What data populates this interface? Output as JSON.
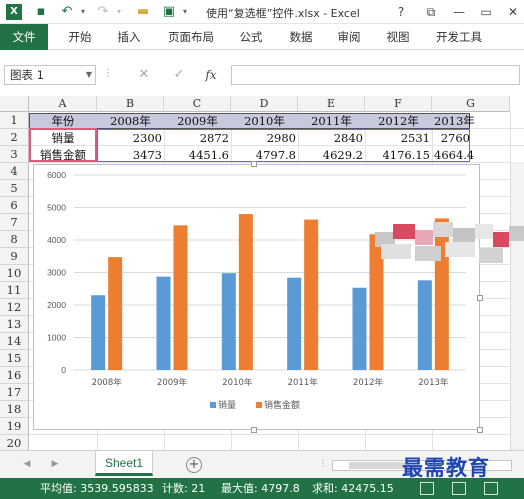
{
  "app": {
    "title": "使用“复选框”控件.xlsx - Excel",
    "logo": "X",
    "help_label": "?",
    "quick_access": [
      "save-icon",
      "undo-icon",
      "redo-icon",
      "open-icon",
      "print-preview-icon"
    ]
  },
  "ribbon": {
    "tabs": [
      "文件",
      "开始",
      "插入",
      "页面布局",
      "公式",
      "数据",
      "审阅",
      "视图",
      "开发工具"
    ]
  },
  "formula_bar": {
    "name_box": "图表 1",
    "cancel": "✕",
    "enter": "✓",
    "fx": "fx",
    "value": ""
  },
  "grid": {
    "columns": [
      "A",
      "B",
      "C",
      "D",
      "E",
      "F",
      "G"
    ],
    "rows": [
      "1",
      "2",
      "3",
      "4",
      "5",
      "6",
      "7",
      "8",
      "9",
      "10",
      "11",
      "12",
      "13",
      "14",
      "15",
      "16",
      "17",
      "18",
      "19",
      "20"
    ],
    "cells": {
      "r1": [
        "年份",
        "2008年",
        "2009年",
        "2010年",
        "2011年",
        "2012年",
        "2013年"
      ],
      "r2": [
        "销量",
        "2300",
        "2872",
        "2980",
        "2840",
        "2531",
        "2760"
      ],
      "r3": [
        "销售金额",
        "3473",
        "4451.6",
        "4797.8",
        "4629.2",
        "4176.15",
        "4664.4"
      ]
    }
  },
  "chart_data": {
    "type": "bar",
    "categories": [
      "2008年",
      "2009年",
      "2010年",
      "2011年",
      "2012年",
      "2013年"
    ],
    "series": [
      {
        "name": "销量",
        "values": [
          2300,
          2872,
          2980,
          2840,
          2531,
          2760
        ],
        "color": "#5b9bd5"
      },
      {
        "name": "销售金额",
        "values": [
          3473,
          4451.6,
          4797.8,
          4629.2,
          4176.15,
          4664.4
        ],
        "color": "#ed7d31"
      }
    ],
    "ylim": [
      0,
      6000
    ],
    "yticks": [
      "0",
      "1000",
      "2000",
      "3000",
      "4000",
      "5000",
      "6000"
    ],
    "grid": true,
    "legend": "bottom"
  },
  "sheets": {
    "active": "Sheet1",
    "add_label": "+"
  },
  "status": {
    "average": "平均值: 3539.595833",
    "count": "计数: 21",
    "max": "最大值: 4797.8",
    "sum": "求和: 42475.15"
  },
  "watermark": "最需教育",
  "colors": {
    "excel_green": "#217346",
    "header_fill": "#c9c9de",
    "selection": "#e05a7b"
  }
}
